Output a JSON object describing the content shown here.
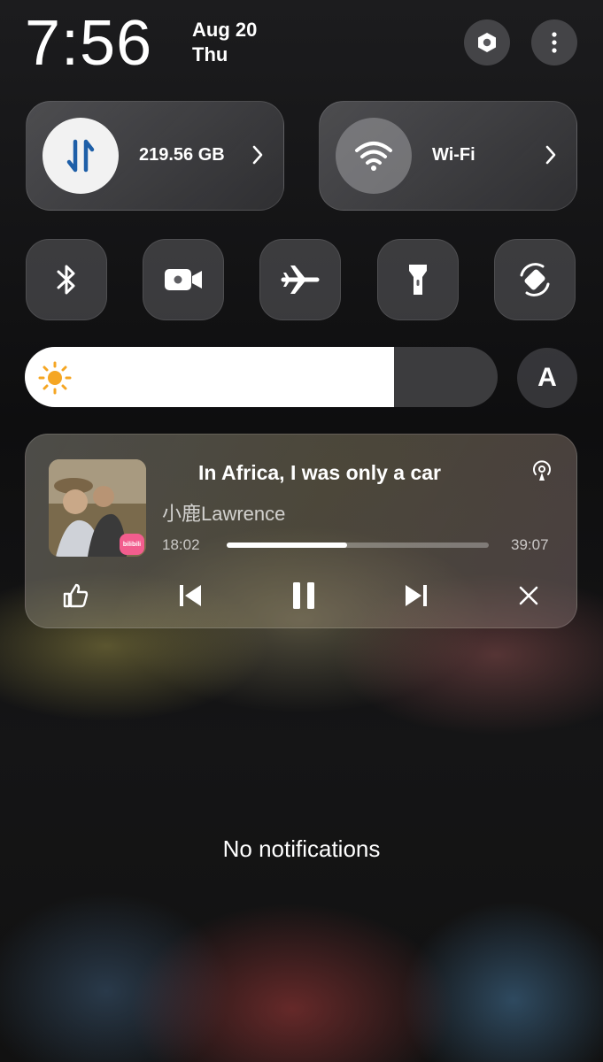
{
  "header": {
    "time": "7:56",
    "date": "Aug 20",
    "day": "Thu",
    "settings_icon": "settings-hex-icon",
    "more_icon": "more-vertical-icon"
  },
  "tiles": {
    "data": {
      "label": "219.56 GB",
      "icon": "mobile-data-arrows-icon",
      "active": true
    },
    "wifi": {
      "label": "Wi-Fi",
      "icon": "wifi-icon",
      "active": false
    }
  },
  "toggles": [
    {
      "name": "bluetooth",
      "icon": "bluetooth-icon"
    },
    {
      "name": "screen-record",
      "icon": "video-camera-icon"
    },
    {
      "name": "airplane-mode",
      "icon": "airplane-icon"
    },
    {
      "name": "flashlight",
      "icon": "flashlight-icon"
    },
    {
      "name": "auto-rotate",
      "icon": "rotate-icon"
    }
  ],
  "brightness": {
    "level_percent": 78,
    "auto_label": "A",
    "icon": "sun-icon"
  },
  "media": {
    "title": "In Africa, I was only a car",
    "artist": "小鹿Lawrence",
    "elapsed": "18:02",
    "duration": "39:07",
    "progress_fraction": 0.46,
    "app_badge": "bilibili",
    "cast_icon": "cast-icon",
    "controls": [
      "thumbs-up-icon",
      "previous-icon",
      "pause-icon",
      "next-icon",
      "close-icon"
    ]
  },
  "notifications": {
    "empty_text": "No notifications"
  },
  "colors": {
    "data_arrow_blue": "#1e5fa8",
    "sun": "#f5a623",
    "badge_pink": "#f25d8e"
  }
}
